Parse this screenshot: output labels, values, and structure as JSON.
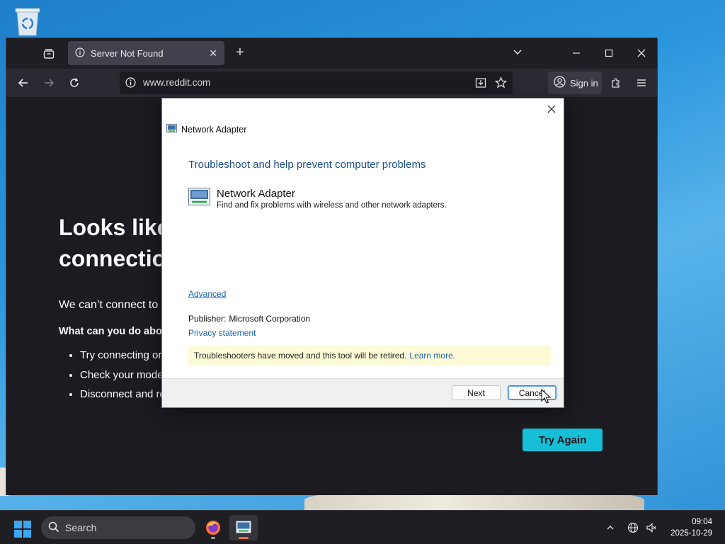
{
  "browser": {
    "tab": {
      "title": "Server Not Found",
      "icon": "info-icon"
    },
    "url": "www.reddit.com",
    "sign_in_label": "Sign in",
    "error": {
      "title_line1": "Looks like",
      "title_line2": "connectio",
      "description": "We can’t connect to",
      "what_can_you_do": "What can you do abo",
      "suggestions": [
        "Try connecting or",
        "Check your mode",
        "Disconnect and re"
      ],
      "try_again_label": "Try Again"
    }
  },
  "dialog": {
    "header_title": "Network Adapter",
    "heading": "Troubleshoot and help prevent computer problems",
    "adapter_name": "Network Adapter",
    "adapter_description": "Find and fix problems with wireless and other network adapters.",
    "advanced_label": "Advanced",
    "publisher_label": "Publisher:",
    "publisher_value": "Microsoft Corporation",
    "privacy_label": "Privacy statement",
    "notice_text": "Troubleshooters have moved and this tool will be retired.",
    "notice_link": "Learn more.",
    "next_label": "Next",
    "cancel_label": "Cancel"
  },
  "taskbar": {
    "search_label": "Search",
    "time": "09:04",
    "date": "2025-10-29"
  },
  "colors": {
    "browser_bg": "#1c1b22",
    "accent_button": "#17bfd6",
    "dialog_heading": "#1c4f8a",
    "link": "#1a5fb4",
    "notice_bg": "#fdfbd7"
  }
}
